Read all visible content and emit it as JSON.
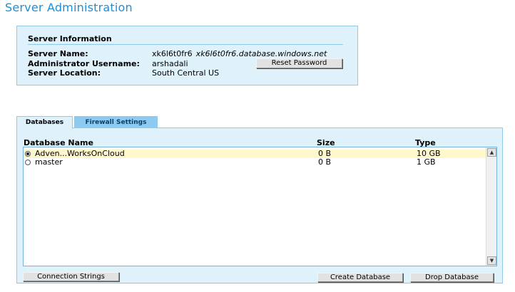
{
  "page": {
    "title": "Server Administration"
  },
  "server_info": {
    "heading": "Server Information",
    "name_label": "Server Name:",
    "name_value": "xk6l6t0fr6",
    "domain": "xk6l6t0fr6.database.windows.net",
    "admin_label": "Administrator Username:",
    "admin_value": "arshadali",
    "location_label": "Server Location:",
    "location_value": "South Central US",
    "reset_password_label": "Reset Password"
  },
  "tabs": [
    {
      "label": "Databases",
      "active": true
    },
    {
      "label": "Firewall Settings",
      "active": false
    }
  ],
  "databases": {
    "columns": [
      "Database Name",
      "Size",
      "Type"
    ],
    "rows": [
      {
        "name": "Adven...WorksOnCloud",
        "size": "0 B",
        "type": "10 GB",
        "selected": true
      },
      {
        "name": "master",
        "size": "0 B",
        "type": "1 GB",
        "selected": false
      }
    ],
    "scroll_up_icon": "arrow-up",
    "scroll_down_icon": "arrow-down"
  },
  "buttons": {
    "connection_strings": "Connection Strings",
    "create_database": "Create Database",
    "drop_database": "Drop Database"
  }
}
